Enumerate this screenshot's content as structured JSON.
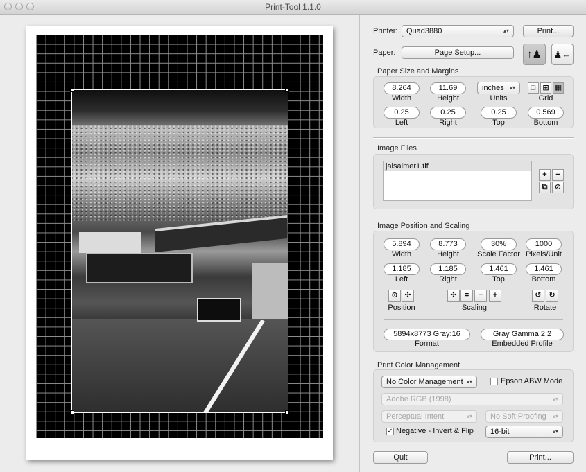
{
  "window": {
    "title": "Print-Tool 1.1.0"
  },
  "printer": {
    "label": "Printer:",
    "value": "Quad3880",
    "print_button": "Print..."
  },
  "paper": {
    "label": "Paper:",
    "setup_button": "Page Setup..."
  },
  "paper_size": {
    "title": "Paper Size and Margins",
    "width": {
      "value": "8.264",
      "label": "Width"
    },
    "height": {
      "value": "11.69",
      "label": "Height"
    },
    "units": {
      "value": "inches",
      "label": "Units"
    },
    "grid_label": "Grid",
    "left": {
      "value": "0.25",
      "label": "Left"
    },
    "right": {
      "value": "0.25",
      "label": "Right"
    },
    "top": {
      "value": "0.25",
      "label": "Top"
    },
    "bottom": {
      "value": "0.569",
      "label": "Bottom"
    }
  },
  "image_files": {
    "title": "Image Files",
    "items": [
      "jaisalmer1.tif"
    ],
    "add": "+",
    "remove": "−"
  },
  "position_scaling": {
    "title": "Image Position and Scaling",
    "width": {
      "value": "5.894",
      "label": "Width"
    },
    "height": {
      "value": "8.773",
      "label": "Height"
    },
    "scale": {
      "value": "30%",
      "label": "Scale Factor"
    },
    "pixels": {
      "value": "1000",
      "label": "Pixels/Unit"
    },
    "left": {
      "value": "1.185",
      "label": "Left"
    },
    "right": {
      "value": "1.185",
      "label": "Right"
    },
    "top": {
      "value": "1.461",
      "label": "Top"
    },
    "bottom": {
      "value": "1.461",
      "label": "Bottom"
    },
    "position_label": "Position",
    "scaling_label": "Scaling",
    "rotate_label": "Rotate",
    "scale_equal": "=",
    "scale_minus": "−",
    "scale_plus": "+",
    "format": {
      "value": "5894x8773 Gray:16",
      "label": "Format"
    },
    "profile": {
      "value": "Gray Gamma 2.2",
      "label": "Embedded Profile"
    }
  },
  "color_management": {
    "title": "Print Color Management",
    "mode": "No Color Management",
    "abw_label": "Epson ABW Mode",
    "profile": "Adobe RGB (1998)",
    "intent": "Perceptual Intent",
    "proofing": "No Soft Proofing",
    "negative_label": "Negative - Invert & Flip",
    "bit_depth": "16-bit"
  },
  "footer": {
    "quit": "Quit",
    "print": "Print..."
  }
}
